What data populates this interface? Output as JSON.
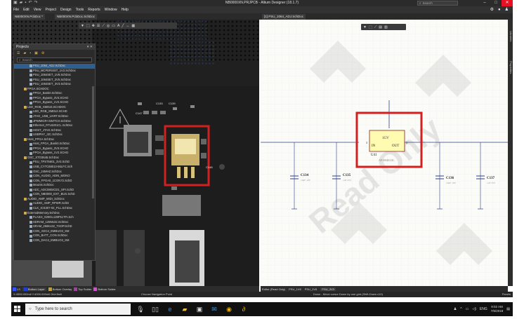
{
  "window": {
    "title": "NB0000XN.PRJPCB - Altium Designer (18.1.7)",
    "search_placeholder": "Search"
  },
  "menu": [
    "File",
    "Edit",
    "View",
    "Project",
    "Design",
    "Tools",
    "Reports",
    "Window",
    "Help"
  ],
  "doc_tabs": {
    "left": [
      {
        "label": "NB000XN.PcbDoc *"
      },
      {
        "label": "NB000XN.PcbDoc.SchDoc"
      }
    ],
    "right": {
      "label": "[1] PSU_1064_ADJ.SchDoc"
    }
  },
  "right_panel_tabs": [
    "Libraries",
    "Properties"
  ],
  "projects_panel": {
    "title": "Projects",
    "search_placeholder": "Search",
    "tree": [
      {
        "label": "PSU_1064_ADJ.SchDoc",
        "selected": true
      },
      {
        "label": "PSU_MCPERSIST_1V2.SchDoc"
      },
      {
        "label": "PSU_1064SET_1V8.SchDoc"
      },
      {
        "label": "PSU_1064SET_2V5.SchDoc"
      },
      {
        "label": "PSU_1064SET_3V3.SchDoc"
      },
      {
        "label": "FPGA.SCHDOC",
        "folder": true
      },
      {
        "label": "FPGA_Bank0.SchDoc"
      },
      {
        "label": "FPGA_Bypass_3V3.SCHD"
      },
      {
        "label": "FPGA_Bypass_1V2.SCHD"
      },
      {
        "label": "LED_RGB_SMDx6.SCHDOC",
        "folder": true
      },
      {
        "label": "LED_RGB_SMDx2.SCHD"
      },
      {
        "label": "JTAG_USB_UART.SchDoc"
      },
      {
        "label": "JPWMICR+SWITCH.SchDoc"
      },
      {
        "label": "Ethernet_RTL8201CL.SchDoc"
      },
      {
        "label": "HOST_JTAG.SchDoc"
      },
      {
        "label": "USBPHY_I2C.SchDoc"
      },
      {
        "label": "Host_FPGA.SchDoc",
        "folder": true
      },
      {
        "label": "Host_FPGA_Bank0.SchDoc"
      },
      {
        "label": "FPGA_Bypass_3V3.SCHD"
      },
      {
        "label": "FPGA_Bypass_1V2.SCHD"
      },
      {
        "label": "OSC_XTO3645.SchDoc",
        "folder": true
      },
      {
        "label": "PSU_TPS75601_3V3.SchD"
      },
      {
        "label": "USB_CY7C68013-56LFC.Sch"
      },
      {
        "label": "OSC_24MHZ.SchDoc"
      },
      {
        "label": "CON_AUDIO_ADIN_MONO"
      },
      {
        "label": "CON_FPGA0_1CON72.SchD"
      },
      {
        "label": "Mounts.SchDoc"
      },
      {
        "label": "ADC_ADC0804CD1_SPI.SchD"
      },
      {
        "label": "CON_NB0000_EXT_BUS.SchD"
      },
      {
        "label": "AUDIO_AMP_MIDI_SchDoc",
        "folder": true
      },
      {
        "label": "AUDIO_AMP_RPWR.SchD"
      },
      {
        "label": "CLK_ICS307-02_PLL.SchDoc"
      },
      {
        "label": "ExternalMemory.SchDoc",
        "folder": true
      },
      {
        "label": "FLASH_S29GL128P11TFI.Sch"
      },
      {
        "label": "SDRAM_128Mx32.SchDoc"
      },
      {
        "label": "SRAM_256Kx32_TSOP.SchD"
      },
      {
        "label": "CON_ADC4_EMBUO3_SM"
      },
      {
        "label": "CON_BATT_CON.SchDoc"
      },
      {
        "label": "CON_DAC4_EMBUO3_SM"
      }
    ]
  },
  "pcb": {
    "labels": [
      "C133",
      "C139",
      "C147",
      "C148",
      "U41",
      "C134",
      "C135",
      "C136",
      "C137"
    ]
  },
  "schematic": {
    "watermark": "Read Only",
    "component": {
      "designator": "U41",
      "net": "1GV",
      "pin_in": "IN",
      "pin_out": "OUT",
      "pin_in_num": "3",
      "pin_out_num": "2",
      "part": "AP1084K33L"
    },
    "caps": [
      {
        "designator": "C134",
        "value": "10uF 10V"
      },
      {
        "designator": "C135",
        "value": "1uF 25V"
      },
      {
        "designator": "C136",
        "value": "10uF 10V"
      },
      {
        "designator": "C137",
        "value": "1uF 25V"
      }
    ]
  },
  "layer_bar": [
    {
      "label": "LS",
      "color": "#3355ff"
    },
    {
      "label": "Bottom Layer",
      "color": "#1f3fd0"
    },
    {
      "label": "Bottom Overlay",
      "color": "#c0a030"
    },
    {
      "label": "Top Solder",
      "color": "#a040a0"
    },
    {
      "label": "Bottom Solder",
      "color": "#d050d0"
    }
  ],
  "editor_bar": {
    "mode": "Editor (Read Only)",
    "tabs": [
      "PSU_1V8",
      "PSU_2V5",
      "PSU_3V3"
    ],
    "active_tab": "PSU_3V3"
  },
  "status": {
    "coords": "X:4555.000mil Y:4000.000mil   Grid:5mil",
    "left_msg": "Choose Navigation Point",
    "right_msg": "Down - Move cursor Down by one grid (Shift-Down x10)",
    "panels": "Panels"
  },
  "taskbar": {
    "search_placeholder": "Type here to search",
    "time": "9:02 AM",
    "date": "7/6/2018"
  }
}
